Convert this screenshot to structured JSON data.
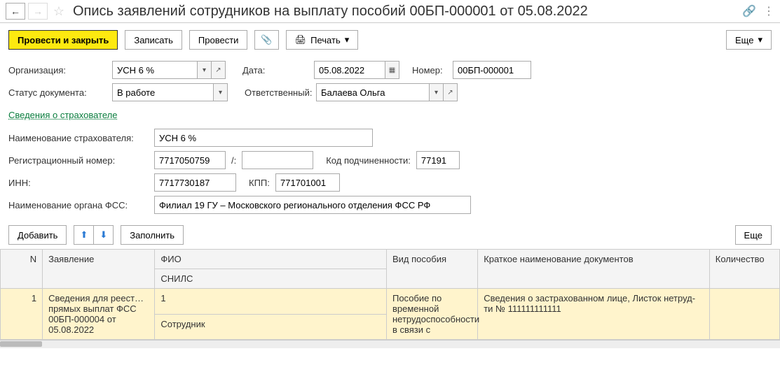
{
  "header": {
    "title": "Опись заявлений сотрудников на выплату пособий 00БП-000001 от 05.08.2022"
  },
  "toolbar": {
    "run_close": "Провести и закрыть",
    "save": "Записать",
    "run": "Провести",
    "print": "Печать",
    "more": "Еще"
  },
  "labels": {
    "org": "Организация:",
    "date": "Дата:",
    "number": "Номер:",
    "status": "Статус документа:",
    "responsible": "Ответственный:",
    "insurer_link": "Сведения о страхователе",
    "insurer_name": "Наименование страхователя:",
    "reg_number": "Регистрационный номер:",
    "slash": "/:",
    "sub_code": "Код подчиненности:",
    "inn": "ИНН:",
    "kpp": "КПП:",
    "fss_name": "Наименование органа ФСС:"
  },
  "values": {
    "org": "УСН 6 %",
    "date": "05.08.2022",
    "number": "00БП-000001",
    "status": "В работе",
    "responsible": "Балаева Ольга",
    "insurer_name": "УСН 6 %",
    "reg_number": "7717050759",
    "reg_number_ext": "",
    "sub_code": "77191",
    "inn": "7717730187",
    "kpp": "771701001",
    "fss_name": "Филиал 19 ГУ – Московского регионального отделения ФСС РФ"
  },
  "table_toolbar": {
    "add": "Добавить",
    "fill": "Заполнить",
    "more": "Еще"
  },
  "table": {
    "columns": {
      "n": "N",
      "app": "Заявление",
      "fio": "ФИО",
      "snils": "СНИЛС",
      "benefit": "Вид пособия",
      "docs": "Краткое наименование документов",
      "qty": "Количество"
    },
    "rows": [
      {
        "n": "1",
        "app": "Сведения для реест… прямых выплат ФСС 00БП-000004 от 05.08.2022",
        "fio": "1",
        "snils": "Сотрудник",
        "benefit": "Пособие по временной нетрудоспособности в связи с",
        "docs": "Сведения о застрахованном лице, Листок нетруд-ти № 111111111111",
        "qty": ""
      }
    ]
  }
}
